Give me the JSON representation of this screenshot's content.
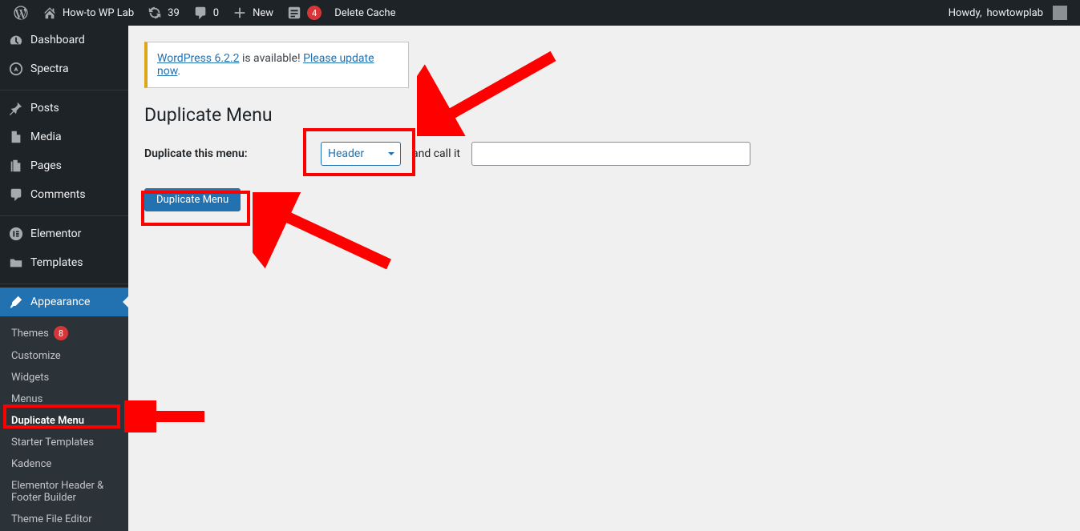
{
  "adminbar": {
    "site_name": "How-to WP Lab",
    "updates_count": "39",
    "comments_count": "0",
    "new_label": "New",
    "wpforms_count": "4",
    "delete_cache_label": "Delete Cache",
    "howdy_prefix": "Howdy, ",
    "username": "howtowplab"
  },
  "sidebar": {
    "items": [
      {
        "id": "dashboard",
        "label": "Dashboard",
        "icon": "dashboard-icon"
      },
      {
        "id": "spectra",
        "label": "Spectra",
        "icon": "spectra-icon"
      },
      {
        "id": "posts",
        "label": "Posts",
        "icon": "pin-icon"
      },
      {
        "id": "media",
        "label": "Media",
        "icon": "media-icon"
      },
      {
        "id": "pages",
        "label": "Pages",
        "icon": "page-icon"
      },
      {
        "id": "comments",
        "label": "Comments",
        "icon": "comment-icon"
      },
      {
        "id": "elementor",
        "label": "Elementor",
        "icon": "elementor-icon"
      },
      {
        "id": "templates",
        "label": "Templates",
        "icon": "folder-icon"
      },
      {
        "id": "appearance",
        "label": "Appearance",
        "icon": "brush-icon"
      }
    ],
    "appearance_submenu": [
      {
        "id": "themes",
        "label": "Themes",
        "badge": "8"
      },
      {
        "id": "customize",
        "label": "Customize"
      },
      {
        "id": "widgets",
        "label": "Widgets"
      },
      {
        "id": "menus",
        "label": "Menus"
      },
      {
        "id": "dupmenu",
        "label": "Duplicate Menu",
        "current": true
      },
      {
        "id": "starter",
        "label": "Starter Templates"
      },
      {
        "id": "kadence",
        "label": "Kadence"
      },
      {
        "id": "ehfb",
        "label": "Elementor Header & Footer Builder"
      },
      {
        "id": "tfe",
        "label": "Theme File Editor"
      }
    ]
  },
  "notice": {
    "prefix": "WordPress 6.2.2",
    "middle": " is available! ",
    "link": "Please update now"
  },
  "page": {
    "title": "Duplicate Menu",
    "form_label": "Duplicate this menu:",
    "select_value": "Header",
    "mid_label": "and call it",
    "input_value": "",
    "input_placeholder": "",
    "submit_label": "Duplicate Menu"
  }
}
